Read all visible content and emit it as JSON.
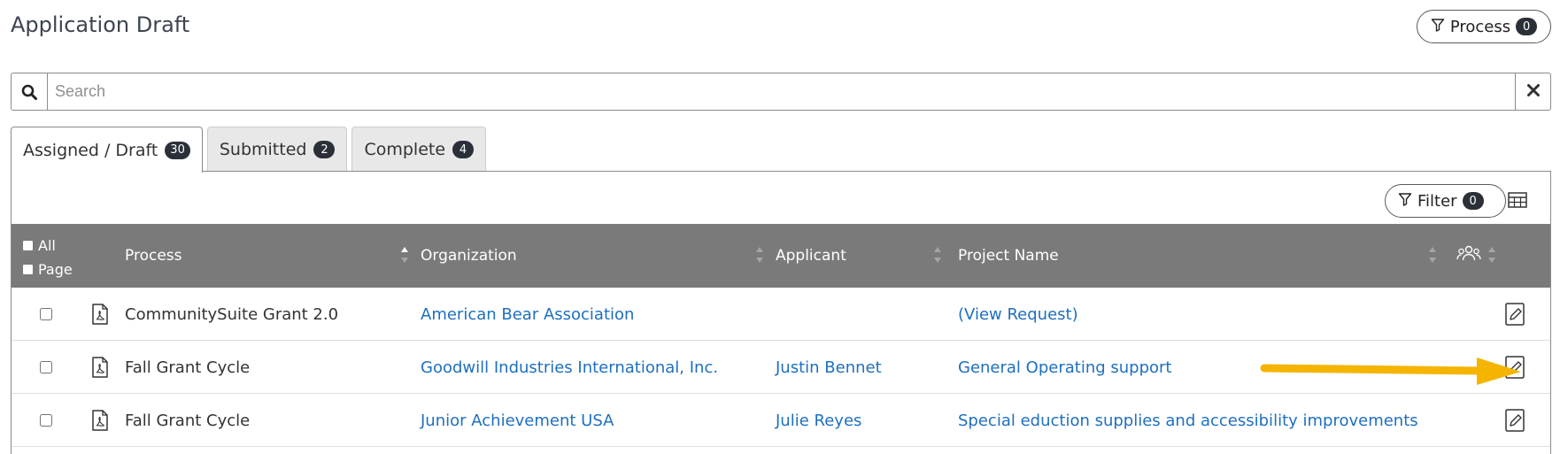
{
  "page": {
    "title": "Application Draft"
  },
  "process_button": {
    "label": "Process",
    "count": "0"
  },
  "search": {
    "placeholder": "Search",
    "value": ""
  },
  "tabs": [
    {
      "label": "Assigned / Draft",
      "count": "30",
      "active": true
    },
    {
      "label": "Submitted",
      "count": "2",
      "active": false
    },
    {
      "label": "Complete",
      "count": "4",
      "active": false
    }
  ],
  "filter_button": {
    "label": "Filter",
    "count": "0"
  },
  "table": {
    "select_all_label": "All",
    "select_page_label": "Page",
    "headers": {
      "process": "Process",
      "organization": "Organization",
      "applicant": "Applicant",
      "project_name": "Project Name"
    },
    "rows": [
      {
        "process": "CommunitySuite Grant 2.0",
        "organization": "American Bear Association",
        "applicant": "",
        "project_name": "(View Request)"
      },
      {
        "process": "Fall Grant Cycle",
        "organization": "Goodwill Industries International, Inc.",
        "applicant": "Justin Bennet",
        "project_name": "General Operating support"
      },
      {
        "process": "Fall Grant Cycle",
        "organization": "Junior Achievement USA",
        "applicant": "Julie Reyes",
        "project_name": "Special eduction supplies and accessibility improvements"
      }
    ]
  },
  "icons": {
    "process_button": "filter-icon",
    "search": "search-icon",
    "clear": "close-icon",
    "grid": "table-columns-icon",
    "group": "users-icon",
    "row_document": "pdf-file-icon",
    "row_action": "edit-document-icon"
  },
  "colors": {
    "header_bg": "#7a7a7a",
    "link": "#1e6fbf",
    "badge": "#2b2f38",
    "annotation_arrow": "#f5b400"
  }
}
